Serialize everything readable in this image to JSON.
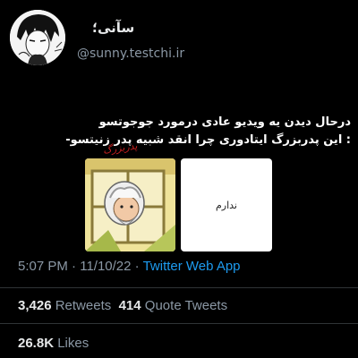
{
  "profile": {
    "display_name": "سآنی؛",
    "handle": "@sunny.testchi.ir"
  },
  "tweet": {
    "line1": "درحال دیدن یه ویدیو عادی درمورد جوجوتسو",
    "line2": ": این پدربزرگ ایتادوری چرا انقد شبیه پدر زنیتسو-"
  },
  "media": {
    "right_image_text": "ندارم",
    "sticker_text": "پدربزرگ"
  },
  "meta": {
    "time": "5:07 PM",
    "separator": "·",
    "date": "11/10/22",
    "source": "Twitter Web App"
  },
  "stats": {
    "retweets_count": "3,426",
    "retweets_label": "Retweets",
    "quotes_count": "414",
    "quotes_label": "Quote Tweets",
    "likes_count": "26.8K",
    "likes_label": "Likes"
  },
  "colors": {
    "background": "#000000",
    "text": "#e7e9ea",
    "muted": "#8b98a5",
    "link": "#1d9bf0"
  }
}
